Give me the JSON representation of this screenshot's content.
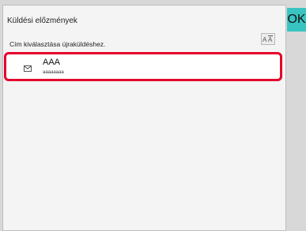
{
  "header": {
    "title": "Küldési előzmények",
    "ok_label": "OK"
  },
  "instruction": "Cím kiválasztása újraküldéshez.",
  "sort": {
    "icon": "sort-az-icon",
    "label": "A-Z"
  },
  "history": {
    "items": [
      {
        "name": "AAA",
        "address": "aaaaaaaa",
        "icon": "email-icon",
        "selected": true
      }
    ]
  },
  "colors": {
    "accent": "#39c4c1",
    "selection": "#e4002b"
  }
}
